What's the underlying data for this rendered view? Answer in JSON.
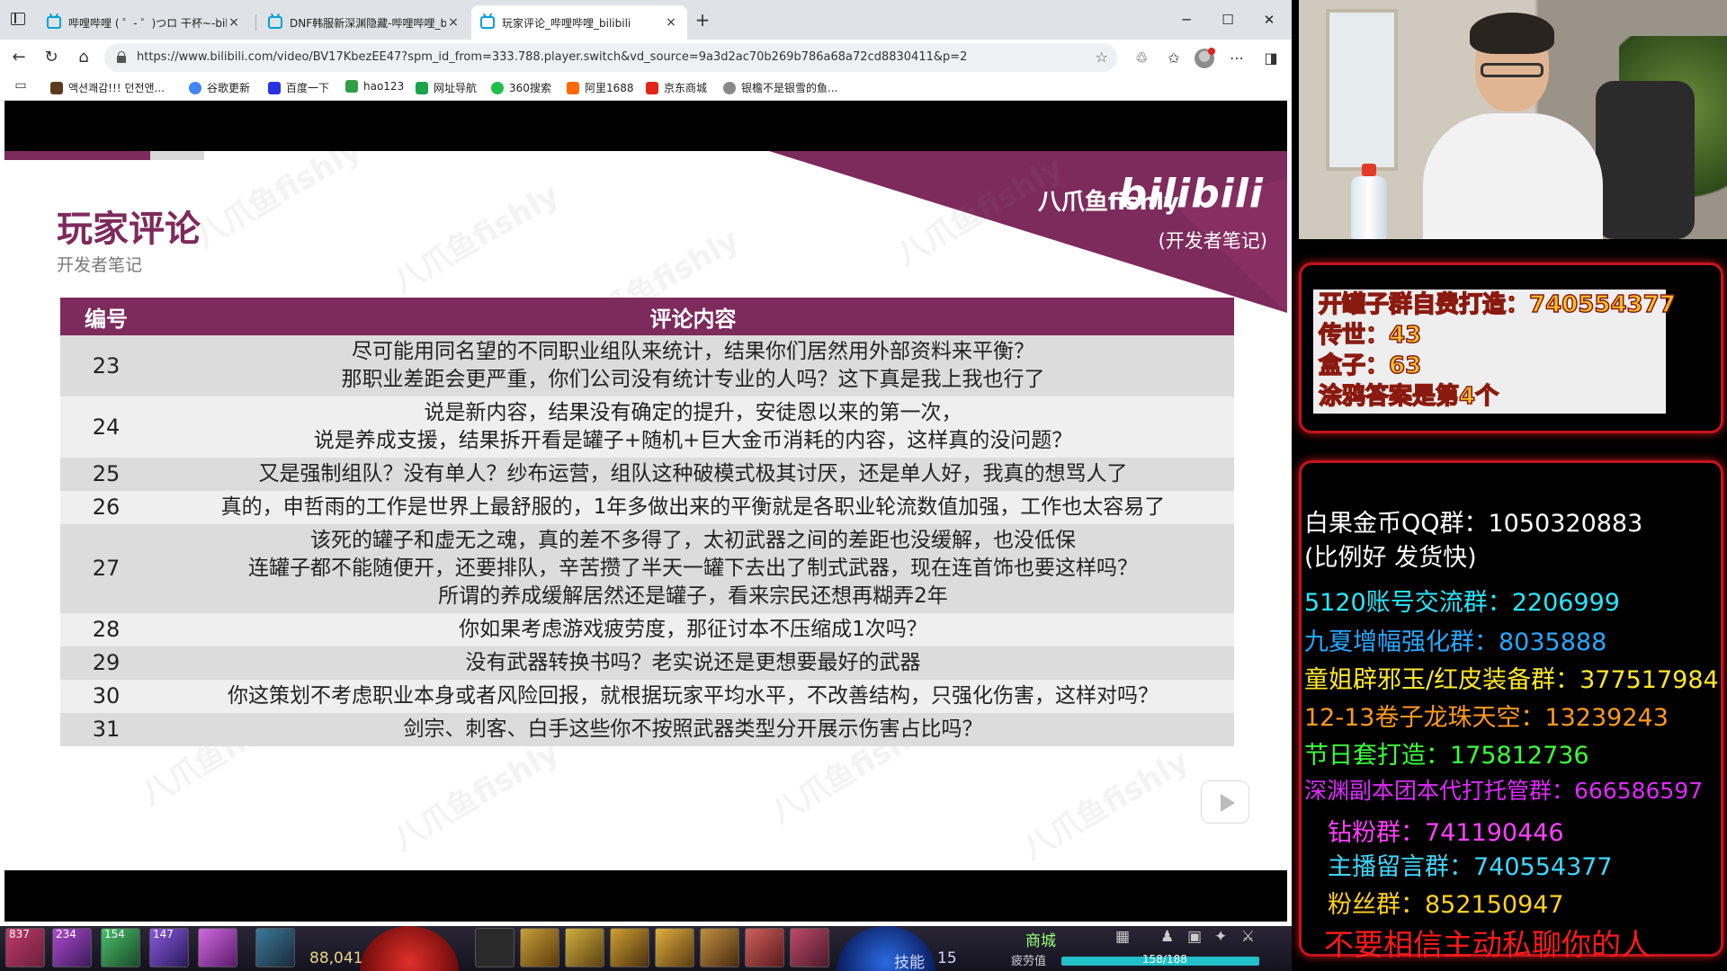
{
  "browser": {
    "tabs": [
      {
        "title": "哔哩哔哩 ( ゜- ゜)つロ 干杯~-bilibili",
        "close": "×"
      },
      {
        "title": "DNF韩服新深渊隐藏-哔哩哔哩_bilibili",
        "close": "×"
      },
      {
        "title": "玩家评论_哔哩哔哩_bilibili",
        "close": "×"
      }
    ],
    "new_tab": "+",
    "window_controls": {
      "minimize": "─",
      "maximize": "☐",
      "close": "✕"
    },
    "url": "https://www.bilibili.com/video/BV17KbezEE47?spm_id_from=333.788.player.switch&vd_source=9a3d2ac70b269b786a68a72cd8830411&p=2",
    "bookmarks": [
      {
        "label": "액션쾌감!!! 던전앤...",
        "color": "#5a3b1f"
      },
      {
        "label": "谷歌更新",
        "color": "#4285f4"
      },
      {
        "label": "百度一下",
        "color": "#2932e1"
      },
      {
        "label": "hao123",
        "color": "#2f9e44"
      },
      {
        "label": "网址导航",
        "color": "#1aa34a"
      },
      {
        "label": "360搜索",
        "color": "#1fbf4a"
      },
      {
        "label": "阿里1688",
        "color": "#ff6a00"
      },
      {
        "label": "京东商城",
        "color": "#e1251b"
      },
      {
        "label": "银檐不是银雪的鱼...",
        "color": "#888888"
      }
    ]
  },
  "slide": {
    "title": "玩家评论",
    "subtitle": "开发者笔记",
    "brand": "八爪鱼fishly",
    "logo": "bilibili",
    "brand_note": "(开发者笔记)",
    "watermark": "八爪鱼fishly",
    "accent": "#7d2a5c",
    "table": {
      "headers": {
        "no": "编号",
        "content": "评论内容"
      },
      "rows": [
        {
          "no": "23",
          "lines": [
            "尽可能用同名望的不同职业组队来统计，结果你们居然用外部资料来平衡？",
            "那职业差距会更严重，你们公司没有统计专业的人吗？这下真是我上我也行了"
          ]
        },
        {
          "no": "24",
          "lines": [
            "说是新内容，结果没有确定的提升，安徒恩以来的第一次，",
            "说是养成支援，结果拆开看是罐子+随机+巨大金币消耗的内容，这样真的没问题？"
          ]
        },
        {
          "no": "25",
          "lines": [
            "又是强制组队？没有单人？纱布运营，组队这种破模式极其讨厌，还是单人好，我真的想骂人了"
          ]
        },
        {
          "no": "26",
          "lines": [
            "真的，申哲雨的工作是世界上最舒服的，1年多做出来的平衡就是各职业轮流数值加强，工作也太容易了"
          ]
        },
        {
          "no": "27",
          "lines": [
            "该死的罐子和虚无之魂，真的差不多得了，太初武器之间的差距也没缓解，也没低保",
            "连罐子都不能随便开，还要排队，辛苦攒了半天一罐下去出了制式武器，现在连首饰也要这样吗？",
            "所谓的养成缓解居然还是罐子，看来宗民还想再糊弄2年"
          ]
        },
        {
          "no": "28",
          "lines": [
            "你如果考虑游戏疲劳度，那征讨本不压缩成1次吗？"
          ]
        },
        {
          "no": "29",
          "lines": [
            "没有武器转换书吗？老实说还是更想要最好的武器"
          ]
        },
        {
          "no": "30",
          "lines": [
            "你这策划不考虑职业本身或者风险回报，就根据玩家平均水平，不改善结构，只强化伤害，这样对吗？"
          ]
        },
        {
          "no": "31",
          "lines": [
            "剑宗、刺客、白手这些你不按照武器类型分开展示伤害占比吗？"
          ]
        }
      ]
    }
  },
  "hud": {
    "slot_numbers": [
      "837",
      "234",
      "154",
      "147"
    ],
    "gold": "88,041",
    "shop": "商城",
    "skill": "技能",
    "skill_value": "15",
    "fatigue": "疲劳值",
    "fatigue_value": "158/188"
  },
  "overlay": {
    "info_box": [
      "开罐子群自费打造：740554377",
      "传世：43",
      "盒子：63",
      "涂鸦答案是第4个"
    ],
    "lines": [
      {
        "text": "白果金币QQ群：1050320883",
        "color": "#ffffff"
      },
      {
        "text": "(比例好 发货快)",
        "color": "#ffffff"
      },
      {
        "text": "5120账号交流群：2206999",
        "color": "#27e8ff"
      },
      {
        "text": "九夏增幅强化群：8035888",
        "color": "#27a8ff"
      },
      {
        "text": "童姐辟邪玉/红皮装备群：377517984",
        "color": "#ffe82a"
      },
      {
        "text": "12-13卷子龙珠天空：13239243",
        "color": "#ff9a1f"
      },
      {
        "text": "节日套打造：175812736",
        "color": "#3cff3c"
      },
      {
        "text": "深渊副本团本代打托管群：666586597",
        "color": "#e02aff"
      },
      {
        "text": "钻粉群：741190446",
        "color": "#ff40ff"
      },
      {
        "text": "主播留言群：740554377",
        "color": "#40d8ff"
      },
      {
        "text": "粉丝群：852150947",
        "color": "#ffd21f"
      },
      {
        "text": "不要相信主动私聊你的人",
        "color": "#ff1a1a"
      }
    ]
  }
}
